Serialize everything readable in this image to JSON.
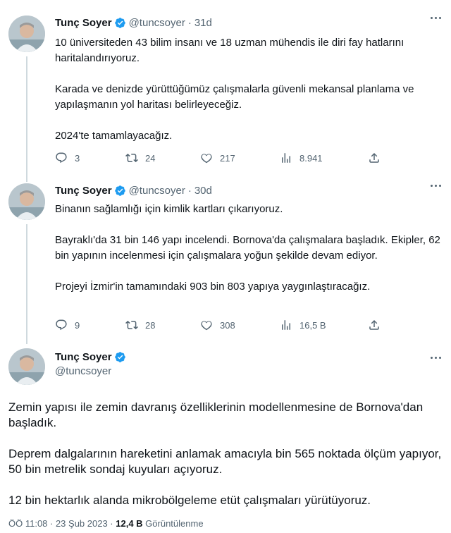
{
  "tweets": [
    {
      "name": "Tunç Soyer",
      "handle": "@tuncsoyer",
      "sep": "·",
      "time": "31d",
      "paragraphs": [
        "10 üniversiteden 43 bilim insanı ve 18 uzman mühendis ile diri fay hatlarını haritalandırıyoruz.",
        "Karada ve denizde yürüttüğümüz çalışmalarla güvenli mekansal planlama ve yapılaşmanın yol haritası belirleyeceğiz.",
        "2024'te tamamlayacağız."
      ],
      "replies": "3",
      "retweets": "24",
      "likes": "217",
      "views": "8.941"
    },
    {
      "name": "Tunç Soyer",
      "handle": "@tuncsoyer",
      "sep": "·",
      "time": "30d",
      "paragraphs": [
        "Binanın sağlamlığı için kimlik kartları çıkarıyoruz.",
        "Bayraklı'da 31 bin 146 yapı incelendi. Bornova'da çalışmalara başladık. Ekipler, 62 bin yapının incelenmesi için çalışmalara yoğun şekilde devam ediyor.",
        "Projeyi İzmir'in tamamındaki 903 bin 803 yapıya yaygınlaştıracağız."
      ],
      "replies": "9",
      "retweets": "28",
      "likes": "308",
      "views": "16,5 B"
    }
  ],
  "main_tweet": {
    "name": "Tunç Soyer",
    "handle": "@tuncsoyer",
    "paragraphs": [
      "Zemin yapısı ile zemin davranış özelliklerinin modellenmesine de Bornova'dan başladık.",
      "Deprem dalgalarının hareketini anlamak amacıyla bin 565 noktada ölçüm yapıyor, 50 bin metrelik sondaj kuyuları açıyoruz.",
      "12 bin hektarlık alanda mikrobölgeleme etüt çalışmaları yürütüyoruz."
    ],
    "timestamp": "ÖÖ 11:08 · 23 Şub 2023 · ",
    "views_count": "12,4 B",
    "views_label": " Görüntülenme"
  },
  "colors": {
    "text": "#0f1419",
    "secondary": "#536471",
    "verified": "#1d9bf0",
    "thread_line": "#cfd9de"
  },
  "icons": [
    "avatar",
    "verified-badge-icon",
    "more-icon",
    "reply-icon",
    "retweet-icon",
    "like-icon",
    "views-icon",
    "share-icon"
  ]
}
